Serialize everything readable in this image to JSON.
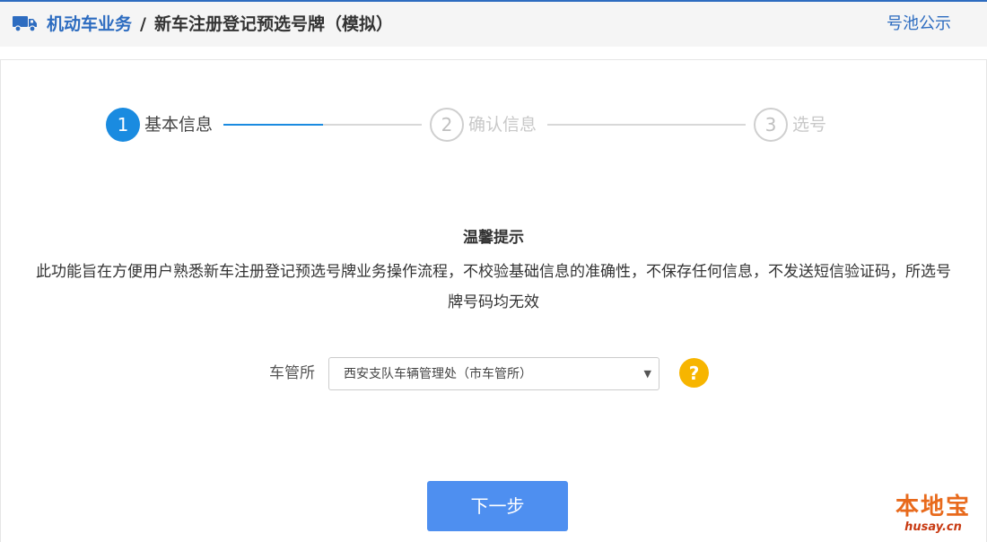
{
  "header": {
    "section": "机动车业务",
    "separator": "/",
    "title": "新车注册登记预选号牌（模拟）",
    "pool_link": "号池公示",
    "accent_color": "#2d6cc0"
  },
  "steps": [
    {
      "number": "1",
      "label": "基本信息",
      "state": "active"
    },
    {
      "number": "2",
      "label": "确认信息",
      "state": "inactive"
    },
    {
      "number": "3",
      "label": "选号",
      "state": "inactive"
    }
  ],
  "step_progress": 0.5,
  "notice": {
    "title": "温馨提示",
    "body": "此功能旨在方便用户熟悉新车注册登记预选号牌业务操作流程，不校验基础信息的准确性，不保存任何信息，不发送短信验证码，所选号牌号码均无效"
  },
  "form": {
    "office_label": "车管所",
    "office_value": "西安支队车辆管理处（市车管所）",
    "help_symbol": "?"
  },
  "next_button": "下一步",
  "watermark": {
    "line1": "本地宝",
    "line2": "husay.cn"
  },
  "icons": {
    "header_icon": "truck-icon",
    "select_caret": "caret-down-icon",
    "help": "question-icon"
  }
}
